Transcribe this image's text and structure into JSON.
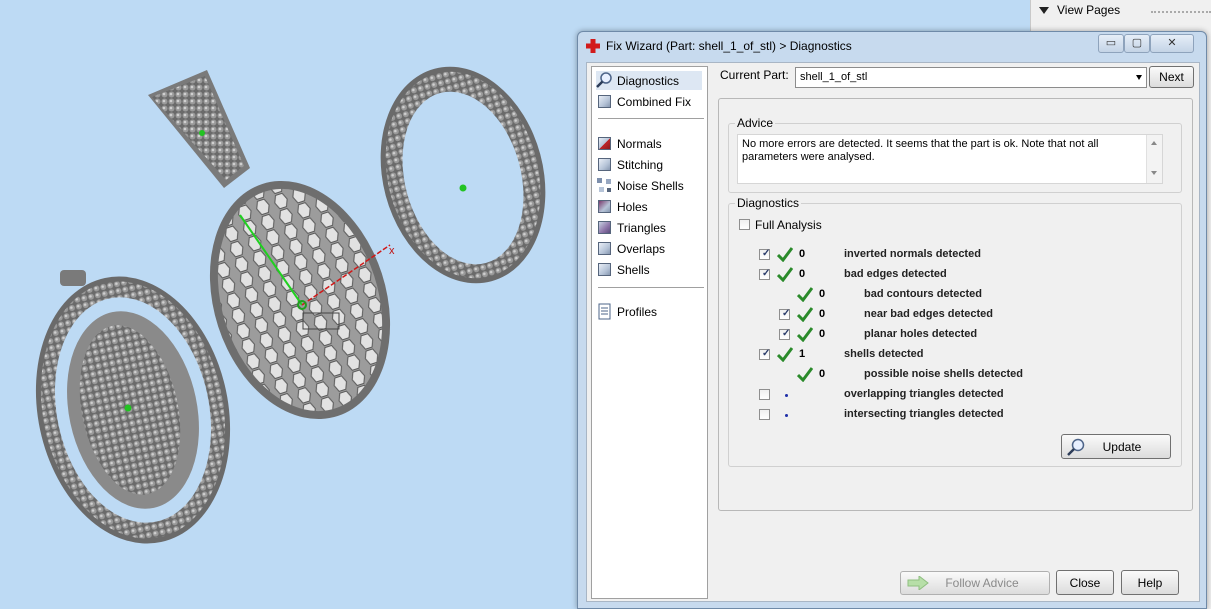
{
  "side_panel": {
    "header": "View Pages"
  },
  "dialog": {
    "title": "Fix Wizard (Part: shell_1_of_stl) > Diagnostics",
    "nav": [
      {
        "label": "Diagnostics",
        "icon": "magnifier-icon"
      },
      {
        "label": "Combined Fix",
        "icon": "cube-icon"
      },
      {
        "label": "Normals",
        "icon": "normals-cube-icon"
      },
      {
        "label": "Stitching",
        "icon": "stitching-cube-icon"
      },
      {
        "label": "Noise Shells",
        "icon": "noise-shells-icon"
      },
      {
        "label": "Holes",
        "icon": "holes-cube-icon"
      },
      {
        "label": "Triangles",
        "icon": "triangles-cube-icon"
      },
      {
        "label": "Overlaps",
        "icon": "overlaps-cube-icon"
      },
      {
        "label": "Shells",
        "icon": "shells-cube-icon"
      },
      {
        "label": "Profiles",
        "icon": "document-icon"
      }
    ],
    "current_part_label": "Current Part:",
    "current_part_value": "shell_1_of_stl",
    "next_label": "Next",
    "advice_title": "Advice",
    "advice_text": "No more errors are detected. It seems that the part is ok. Note that not all parameters were analysed.",
    "diagnostics_title": "Diagnostics",
    "full_analysis_label": "Full Analysis",
    "rows": [
      {
        "label": "inverted normals detected",
        "count": "0",
        "checkbox": true,
        "checked": true,
        "status": "ok"
      },
      {
        "label": "bad edges detected",
        "count": "0",
        "checkbox": true,
        "checked": true,
        "status": "ok"
      },
      {
        "label": "bad contours detected",
        "count": "0",
        "checkbox": false,
        "checked": false,
        "status": "ok"
      },
      {
        "label": "near bad edges detected",
        "count": "0",
        "checkbox": true,
        "checked": true,
        "status": "ok"
      },
      {
        "label": "planar holes detected",
        "count": "0",
        "checkbox": true,
        "checked": true,
        "status": "ok"
      },
      {
        "label": "shells detected",
        "count": "1",
        "checkbox": true,
        "checked": true,
        "status": "ok"
      },
      {
        "label": "possible noise shells detected",
        "count": "0",
        "checkbox": false,
        "checked": false,
        "status": "ok"
      },
      {
        "label": "overlapping triangles detected",
        "count": "",
        "checkbox": true,
        "checked": false,
        "status": "pending"
      },
      {
        "label": "intersecting triangles detected",
        "count": "",
        "checkbox": true,
        "checked": false,
        "status": "pending"
      }
    ],
    "update_label": "Update",
    "follow_advice_label": "Follow Advice",
    "close_label": "Close",
    "help_label": "Help"
  },
  "viewport": {
    "axis_x_label": "x"
  },
  "colors": {
    "viewport_bg": "#bddaf4",
    "tick_green": "#2a8a2a",
    "dialog_frame": "#c7daee"
  }
}
